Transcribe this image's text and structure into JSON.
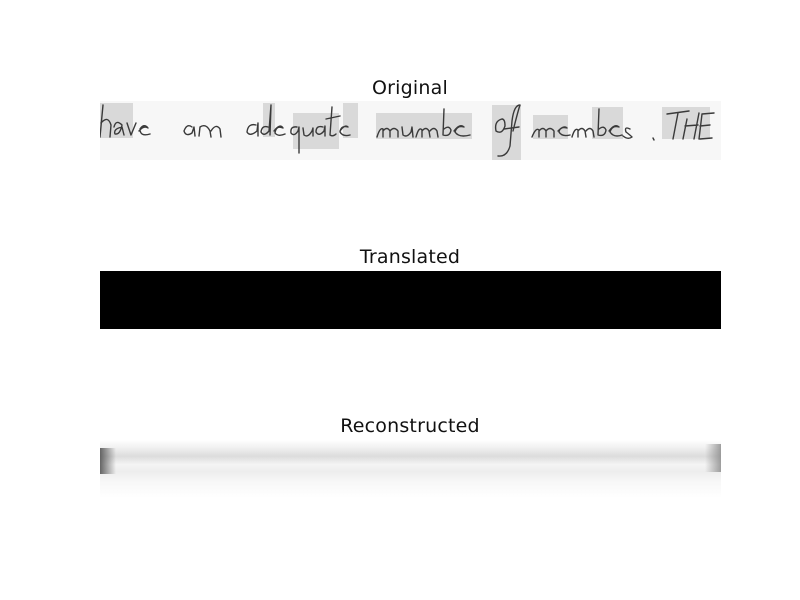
{
  "panels": [
    {
      "title": "Original",
      "handwriting_text": "have an adequate numbe of membes .THE"
    },
    {
      "title": "Translated"
    },
    {
      "title": "Reconstructed"
    }
  ],
  "colors": {
    "background": "#ffffff",
    "translated_fill": "#000000",
    "ink": "#3a3a3a",
    "word_highlight": "#d9d9d9"
  }
}
